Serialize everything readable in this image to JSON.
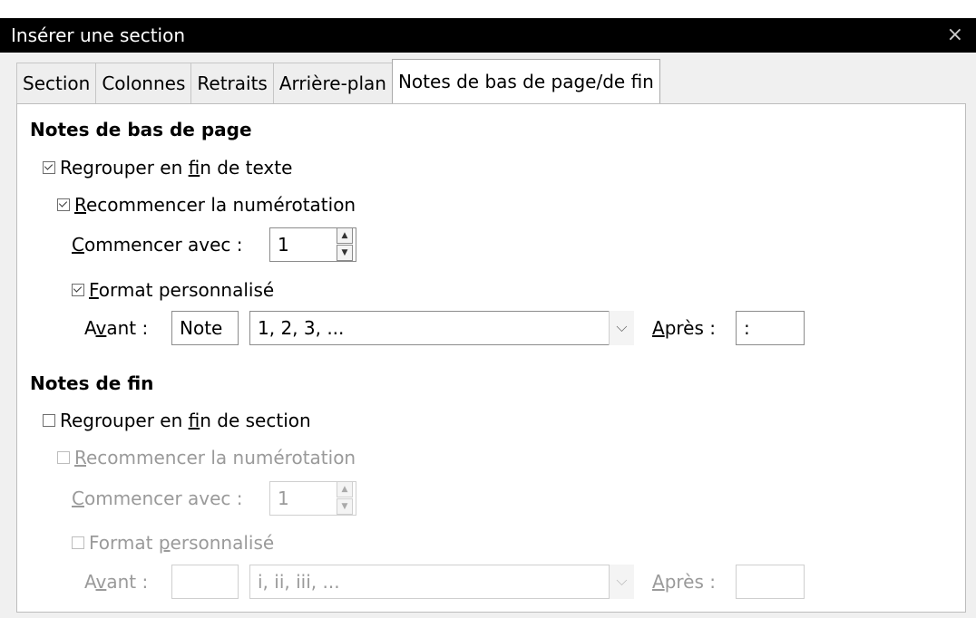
{
  "dialog": {
    "title": "Insérer une section",
    "close_glyph": "×"
  },
  "tabs": [
    {
      "label": "Section"
    },
    {
      "label": "Colonnes"
    },
    {
      "label": "Retraits"
    },
    {
      "label": "Arrière-plan"
    },
    {
      "label": "Notes de bas de page/de fin"
    }
  ],
  "footnotes": {
    "heading": "Notes de bas de page",
    "collect_at_end": {
      "label_pre": "Regrouper en ",
      "label_u": "f",
      "label_post": "in de texte",
      "checked": true
    },
    "restart_numbering": {
      "label_pre": "",
      "label_u": "R",
      "label_post": "ecommencer la numérotation",
      "checked": true
    },
    "start_at": {
      "label_pre": "",
      "label_u": "C",
      "label_post": "ommencer avec :",
      "value": "1"
    },
    "custom_format": {
      "label_pre": "",
      "label_u": "F",
      "label_post": "ormat personnalisé",
      "checked": true
    },
    "before": {
      "label_pre": "A",
      "label_u": "v",
      "label_post": "ant :",
      "value": "Note"
    },
    "format_select": {
      "value": "1, 2, 3, ..."
    },
    "after": {
      "label_pre": "",
      "label_u": "A",
      "label_post": "près :",
      "value": ":"
    }
  },
  "endnotes": {
    "heading": "Notes de fin",
    "collect_at_end": {
      "label_pre": "Regrouper en ",
      "label_u": "f",
      "label_post": "in de section",
      "checked": false
    },
    "restart_numbering": {
      "label_pre": "",
      "label_u": "R",
      "label_post": "ecommencer la numérotation",
      "checked": false
    },
    "start_at": {
      "label_pre": "",
      "label_u": "C",
      "label_post": "ommencer avec :",
      "value": "1"
    },
    "custom_format": {
      "label_pre": "Format ",
      "label_u": "p",
      "label_post": "ersonnalisé",
      "checked": false
    },
    "before": {
      "label_pre": "A",
      "label_u": "v",
      "label_post": "ant :",
      "value": ""
    },
    "format_select": {
      "value": "i, ii, iii, ..."
    },
    "after": {
      "label_pre": "",
      "label_u": "A",
      "label_post": "près :",
      "value": ""
    }
  }
}
